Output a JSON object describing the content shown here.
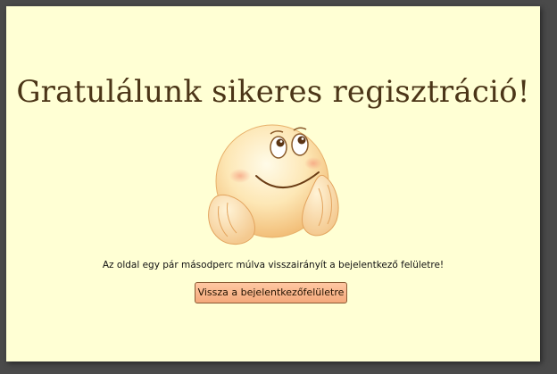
{
  "page": {
    "title": "Gratulálunk sikeres regisztráció!",
    "message": "Az oldal egy pár másodperc múlva visszairányít a bejelentkező felületre!",
    "back_button_label": "Vissza a bejelentkezőfelületre"
  },
  "icons": {
    "illustration": "happy-smiley-emoji-icon"
  },
  "colors": {
    "background": "#ffffd4",
    "title_text": "#4b3517",
    "button_fill": "#f6b18a",
    "button_border": "#8a5a34"
  }
}
